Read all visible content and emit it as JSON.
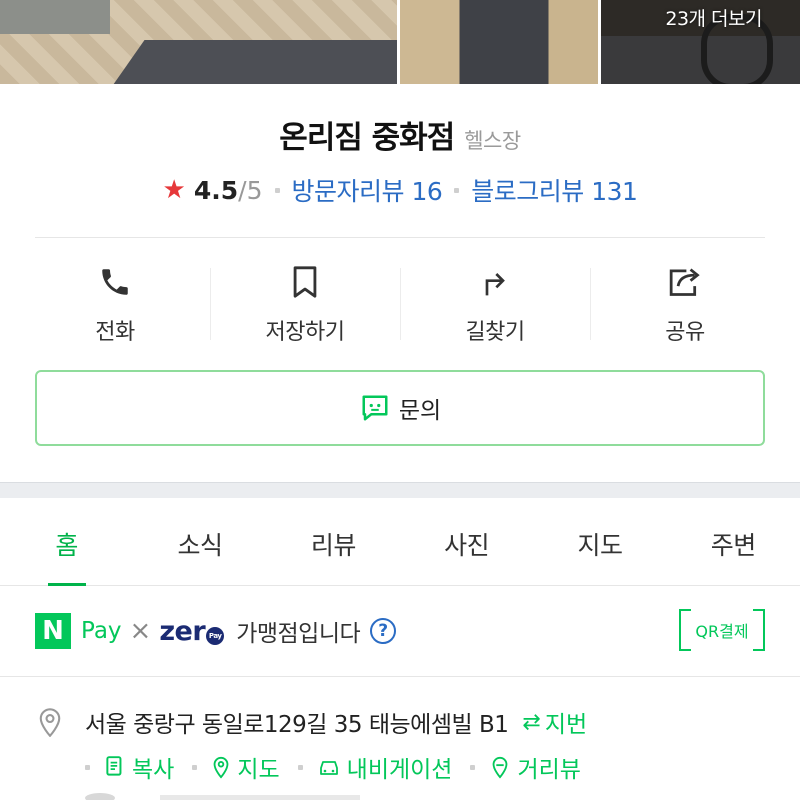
{
  "photos": {
    "more_label": "23개 더보기"
  },
  "place": {
    "name": "온리짐 중화점",
    "category": "헬스장"
  },
  "rating": {
    "value": "4.5",
    "max": "/5",
    "visitor_reviews": "방문자리뷰 16",
    "blog_reviews": "블로그리뷰 131"
  },
  "actions": [
    {
      "label": "전화",
      "icon": "phone-icon"
    },
    {
      "label": "저장하기",
      "icon": "bookmark-icon"
    },
    {
      "label": "길찾기",
      "icon": "directions-icon"
    },
    {
      "label": "공유",
      "icon": "share-icon"
    }
  ],
  "inquiry": {
    "label": "문의",
    "icon": "chat-icon"
  },
  "tabs": [
    {
      "label": "홈",
      "active": true
    },
    {
      "label": "소식"
    },
    {
      "label": "리뷰"
    },
    {
      "label": "사진"
    },
    {
      "label": "지도"
    },
    {
      "label": "주변"
    }
  ],
  "pay": {
    "npay_badge": "N",
    "npay_word": "Pay",
    "times": "×",
    "zero_word": "zer",
    "zero_badge": "Pay",
    "description": "가맹점입니다",
    "help": "?",
    "qr_label": "QR결제"
  },
  "address": {
    "text": "서울 중랑구 동일로129길 35 태능에셈빌 B1",
    "jibun_label": "지번",
    "links": [
      {
        "label": "복사",
        "icon": "copy-icon"
      },
      {
        "label": "지도",
        "icon": "map-pin-icon"
      },
      {
        "label": "내비게이션",
        "icon": "car-icon"
      },
      {
        "label": "거리뷰",
        "icon": "street-view-icon"
      }
    ]
  },
  "colors": {
    "brand_green": "#03c75a",
    "link_blue": "#2b6cc4",
    "star_red": "#e6383a"
  }
}
